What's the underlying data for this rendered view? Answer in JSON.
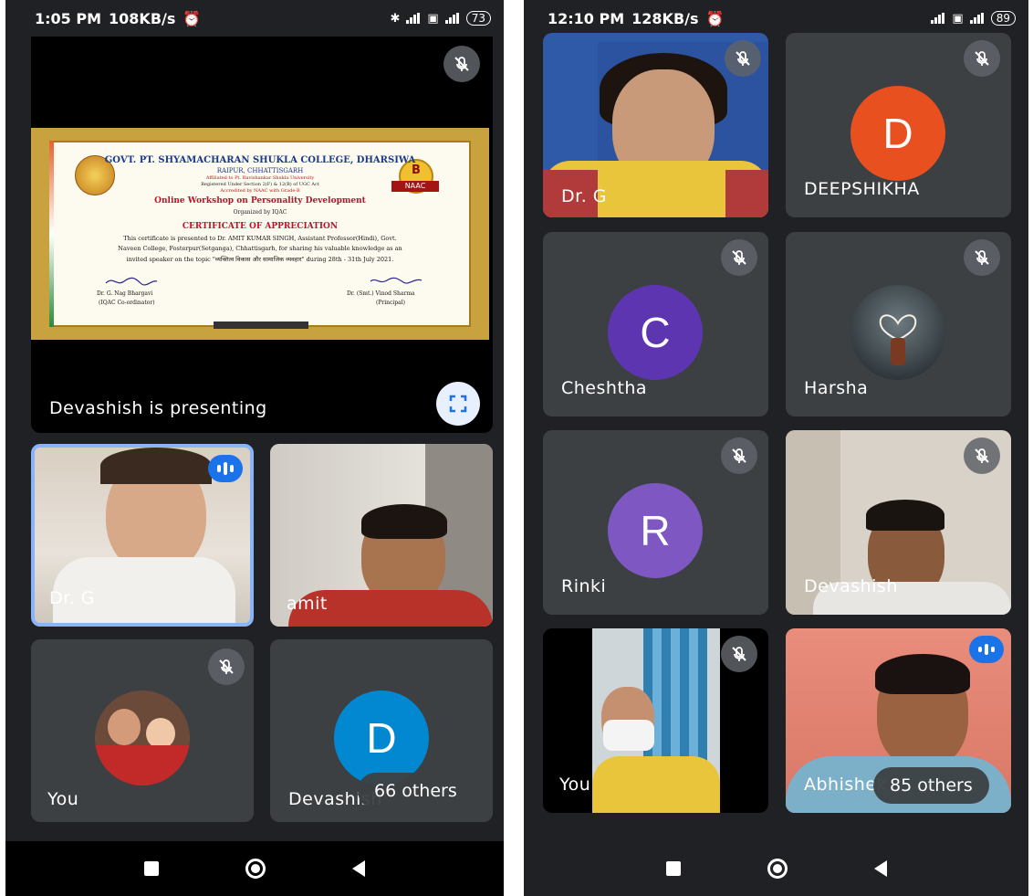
{
  "left": {
    "status": {
      "time": "1:05 PM",
      "speed": "108KB/s",
      "battery": "73"
    },
    "presentation": {
      "label": "Devashish is presenting",
      "certificate": {
        "college": "GOVT. PT. SHYAMACHARAN SHUKLA COLLEGE, DHARSIWA",
        "city": "RAIPUR, CHHATTISGARH",
        "affil1": "Affiliated to Pt. Ravishankar Shukla University",
        "affil2": "Registered Under Section 2(F) & 12(B) of UGC Act",
        "affil3": "Accredited by NAAC with Grade-B",
        "workshop": "Online Workshop on Personality Development",
        "organized": "Organized by IQAC",
        "heading": "CERTIFICATE OF APPRECIATION",
        "body1": "This certificate is presented to Dr. AMIT KUMAR SINGH, Assistant Professor(Hindi), Govt.",
        "body2": "Naveen College, Fosterpur(Setganga), Chhattisgarh, for sharing his valuable knowledge as an",
        "body3": "invited speaker on the topic \"व्यक्तित्व विकास और सामाजिक व्यवहार\" during 28th - 31th July 2021.",
        "sig1_name": "Dr. G. Nag Bhargavi",
        "sig1_role": "(IQAC Co-ordinator)",
        "sig2_name": "Dr. (Smt.) Vinod Sharma",
        "sig2_role": "(Principal)",
        "badge_letter": "B",
        "badge_text": "NAAC"
      }
    },
    "tiles": [
      {
        "name": "Dr. G"
      },
      {
        "name": "amit"
      },
      {
        "name": "You"
      },
      {
        "name": "Devashish",
        "initial": "D",
        "others": "66 others"
      }
    ]
  },
  "right": {
    "status": {
      "time": "12:10 PM",
      "speed": "128KB/s",
      "battery": "89"
    },
    "tiles": [
      {
        "name": "Dr. G"
      },
      {
        "name": "DEEPSHIKHA",
        "initial": "D"
      },
      {
        "name": "Cheshtha",
        "initial": "C"
      },
      {
        "name": "Harsha"
      },
      {
        "name": "Rinki",
        "initial": "R"
      },
      {
        "name": "Devashish"
      },
      {
        "name": "You"
      },
      {
        "name": "Abhishek",
        "others": "85 others"
      }
    ]
  },
  "colors": {
    "bg": "#202124",
    "tile": "#3c4043",
    "avatar_d_blue": "#0288d1",
    "avatar_d_orange": "#e8511f",
    "avatar_purple": "#5e35b1",
    "avatar_r": "#7e57c2",
    "accent": "#1a73e8"
  }
}
